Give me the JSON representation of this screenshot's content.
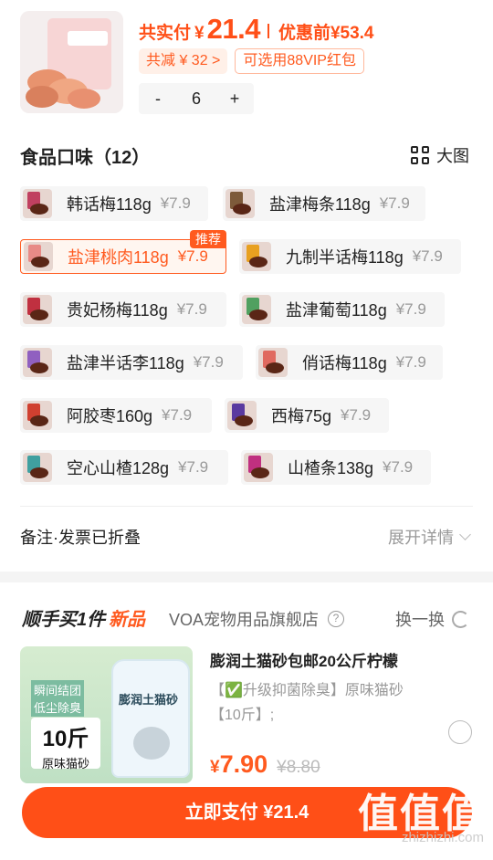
{
  "order": {
    "paid_label": "共实付",
    "currency": "¥",
    "paid_amount": "21.4",
    "original_label": "优惠前",
    "original_price": "¥53.4",
    "discount_tag": "共减 ¥ 32 >",
    "vip_tag": "可选用88VIP红包",
    "quantity": "6",
    "minus": "-",
    "plus": "+"
  },
  "flavors": {
    "title": "食品口味（12）",
    "big_view": "大图",
    "recommend_badge": "推荐",
    "items": [
      {
        "name": "韩话梅118g",
        "price": "¥7.9",
        "pack": "#c04060"
      },
      {
        "name": "盐津梅条118g",
        "price": "¥7.9",
        "pack": "#7d5a3a"
      },
      {
        "name": "盐津桃肉118g",
        "price": "¥7.9",
        "pack": "#e88a86"
      },
      {
        "name": "九制半话梅118g",
        "price": "¥7.9",
        "pack": "#e8a020"
      },
      {
        "name": "贵妃杨梅118g",
        "price": "¥7.9",
        "pack": "#c03040"
      },
      {
        "name": "盐津葡萄118g",
        "price": "¥7.9",
        "pack": "#50a060"
      },
      {
        "name": "盐津半话李118g",
        "price": "¥7.9",
        "pack": "#9060c0"
      },
      {
        "name": "俏话梅118g",
        "price": "¥7.9",
        "pack": "#e06a60"
      },
      {
        "name": "阿胶枣160g",
        "price": "¥7.9",
        "pack": "#d04030"
      },
      {
        "name": "西梅75g",
        "price": "¥7.9",
        "pack": "#5a3aa0"
      },
      {
        "name": "空心山楂128g",
        "price": "¥7.9",
        "pack": "#40a0a0"
      },
      {
        "name": "山楂条138g",
        "price": "¥7.9",
        "pack": "#c03080"
      }
    ]
  },
  "remark": {
    "label": "备注·发票已折叠",
    "expand": "展开详情"
  },
  "buy_along": {
    "title": "顺手买1件",
    "new_label": "新品",
    "shop": "VOA宠物用品旗舰店",
    "swap": "换一换",
    "product": {
      "img_line1": "瞬间结团",
      "img_line2": "低尘除臭",
      "img_weight": "10斤",
      "img_flavor": "原味猫砂",
      "img_bag_text": "膨润土猫砂",
      "title": "膨润土猫砂包邮20公斤柠檬",
      "subtitle": "【✅升级抑菌除臭】原味猫砂【10斤】;",
      "currency": "¥",
      "price": "7.90",
      "orig_price": "¥8.80"
    }
  },
  "pay": {
    "button": "立即支付 ¥21.4"
  },
  "watermark": {
    "cn": "值值值",
    "url": "zhizhizhi.com"
  }
}
